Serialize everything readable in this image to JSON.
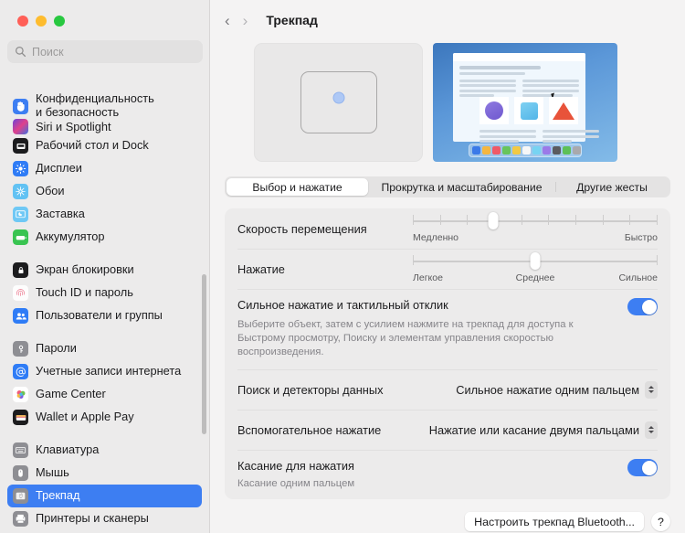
{
  "window": {
    "traffic_lights": [
      "close",
      "minimize",
      "zoom"
    ],
    "colors": {
      "accent": "#3d7ef2",
      "sidebar_bg": "#ecebeb",
      "main_bg": "#f4f3f3",
      "selected_text": "#ffffff"
    }
  },
  "search": {
    "placeholder": "Поиск",
    "value": "",
    "icon": "search-icon"
  },
  "sidebar": {
    "partial_item": {
      "label": "Siri и Spotlight",
      "icon": "siri-icon"
    },
    "groups": [
      {
        "items": [
          {
            "label": "Конфиденциальность и безопасность",
            "icon": "hand-icon",
            "icon_color": "#3d7ef2",
            "two_line": true,
            "selected": false
          }
        ]
      },
      {
        "items": [
          {
            "label": "Рабочий стол и Dock",
            "icon": "dock-icon",
            "icon_color": "#1c1c1e",
            "selected": false
          },
          {
            "label": "Дисплеи",
            "icon": "display-icon",
            "icon_color": "#2f7cf6",
            "selected": false
          },
          {
            "label": "Обои",
            "icon": "wallpaper-icon",
            "icon_color": "#62c2f3",
            "selected": false
          },
          {
            "label": "Заставка",
            "icon": "screensaver-icon",
            "icon_color": "#6fc8f5",
            "selected": false
          },
          {
            "label": "Аккумулятор",
            "icon": "battery-icon",
            "icon_color": "#39c451",
            "selected": false
          }
        ]
      },
      {
        "items": [
          {
            "label": "Экран блокировки",
            "icon": "lock-screen-icon",
            "icon_color": "#1c1c1e",
            "selected": false
          },
          {
            "label": "Touch ID и пароль",
            "icon": "touch-id-icon",
            "icon_color": "#ffffff",
            "selected": false
          },
          {
            "label": "Пользователи и группы",
            "icon": "users-icon",
            "icon_color": "#2f7cf6",
            "selected": false
          }
        ]
      },
      {
        "items": [
          {
            "label": "Пароли",
            "icon": "key-icon",
            "icon_color": "#8e8e93",
            "selected": false
          },
          {
            "label": "Учетные записи интернета",
            "icon": "at-sign-icon",
            "icon_color": "#2f7cf6",
            "selected": false
          },
          {
            "label": "Game Center",
            "icon": "game-center-icon",
            "icon_color": "#ffffff",
            "selected": false
          },
          {
            "label": "Wallet и Apple Pay",
            "icon": "wallet-icon",
            "icon_color": "#1c1c1e",
            "selected": false
          }
        ]
      },
      {
        "items": [
          {
            "label": "Клавиатура",
            "icon": "keyboard-icon",
            "icon_color": "#8e8e93",
            "selected": false
          },
          {
            "label": "Мышь",
            "icon": "mouse-icon",
            "icon_color": "#8e8e93",
            "selected": false
          },
          {
            "label": "Трекпад",
            "icon": "trackpad-icon",
            "icon_color": "#8e8e93",
            "selected": true
          },
          {
            "label": "Принтеры и сканеры",
            "icon": "printer-icon",
            "icon_color": "#8e8e93",
            "selected": false
          }
        ]
      }
    ]
  },
  "toolbar": {
    "back_icon": "chevron-left-icon",
    "forward_icon": "chevron-right-icon",
    "title": "Трекпад"
  },
  "preview": {
    "left": {
      "name": "trackpad-illustration",
      "dot": "pointer-dot"
    },
    "right": {
      "name": "desktop-animation-preview",
      "dock_colors": [
        "#3b7ae8",
        "#f4b63f",
        "#ee5a67",
        "#68c45c",
        "#f2c945",
        "#f7f7f7",
        "#77d3f2",
        "#9b7ae8",
        "#5b5b5f",
        "#5dc057",
        "#a9a9ad"
      ],
      "shapes": [
        "circle",
        "square",
        "triangle"
      ]
    }
  },
  "tabs": [
    {
      "label": "Выбор и нажатие",
      "active": true
    },
    {
      "label": "Прокрутка и масштабирование",
      "active": false
    },
    {
      "label": "Другие жесты",
      "active": false
    }
  ],
  "settings": {
    "tracking_speed": {
      "label": "Скорость перемещения",
      "min_label": "Медленно",
      "max_label": "Быстро",
      "ticks": 10,
      "value_index": 3,
      "thumb_percent": 33
    },
    "click_pressure": {
      "label": "Нажатие",
      "labels": [
        "Легкое",
        "Среднее",
        "Сильное"
      ],
      "thumb_percent": 50
    },
    "force_click": {
      "title": "Сильное нажатие и тактильный отклик",
      "subtitle": "Выберите объект, затем с усилием нажмите на трекпад для доступа к Быстрому просмотру, Поиску и элементам управления скоростью воспроизведения.",
      "enabled": true
    },
    "lookup": {
      "label": "Поиск и детекторы данных",
      "value": "Сильное нажатие одним пальцем"
    },
    "secondary_click": {
      "label": "Вспомогательное нажатие",
      "value": "Нажатие или касание двумя пальцами"
    },
    "tap_to_click": {
      "label": "Касание для нажатия",
      "subtitle": "Касание одним пальцем",
      "enabled": true
    }
  },
  "footer": {
    "setup_button": "Настроить трекпад Bluetooth...",
    "help_button": "?"
  }
}
